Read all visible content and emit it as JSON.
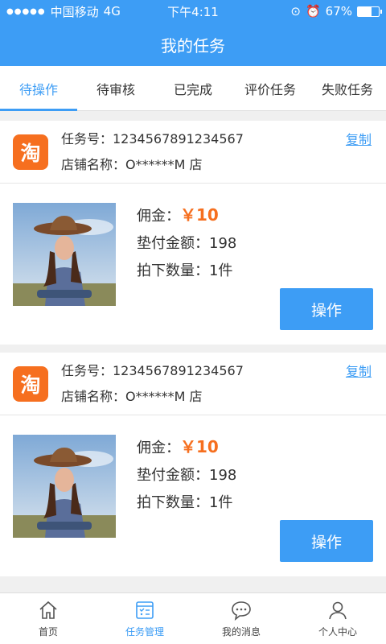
{
  "status": {
    "carrier": "中国移动",
    "network": "4G",
    "time": "下午4:11",
    "battery": "67%",
    "battery_level": 0.67
  },
  "header": {
    "title": "我的任务"
  },
  "tabs": [
    {
      "label": "待操作"
    },
    {
      "label": "待审核"
    },
    {
      "label": "已完成"
    },
    {
      "label": "评价任务"
    },
    {
      "label": "失败任务"
    }
  ],
  "tasks": [
    {
      "shop_badge": "淘",
      "task_number": "任务号：1234567891234567",
      "shop_name": "店铺名称：O******M 店",
      "copy_label": "复制",
      "commission_label": "佣金：",
      "commission_value": "￥10",
      "advance_amount": "垫付金额：198",
      "quantity": "拍下数量：1件",
      "action_label": "操作"
    },
    {
      "shop_badge": "淘",
      "task_number": "任务号：1234567891234567",
      "shop_name": "店铺名称：O******M 店",
      "copy_label": "复制",
      "commission_label": "佣金：",
      "commission_value": "￥10",
      "advance_amount": "垫付金额：198",
      "quantity": "拍下数量：1件",
      "action_label": "操作"
    }
  ],
  "bottom_nav": [
    {
      "label": "首页",
      "icon": "home-icon"
    },
    {
      "label": "任务管理",
      "icon": "task-list-icon"
    },
    {
      "label": "我的消息",
      "icon": "message-icon"
    },
    {
      "label": "个人中心",
      "icon": "person-icon"
    }
  ],
  "colors": {
    "primary": "#3d9df5",
    "accent": "#f66f1f"
  }
}
